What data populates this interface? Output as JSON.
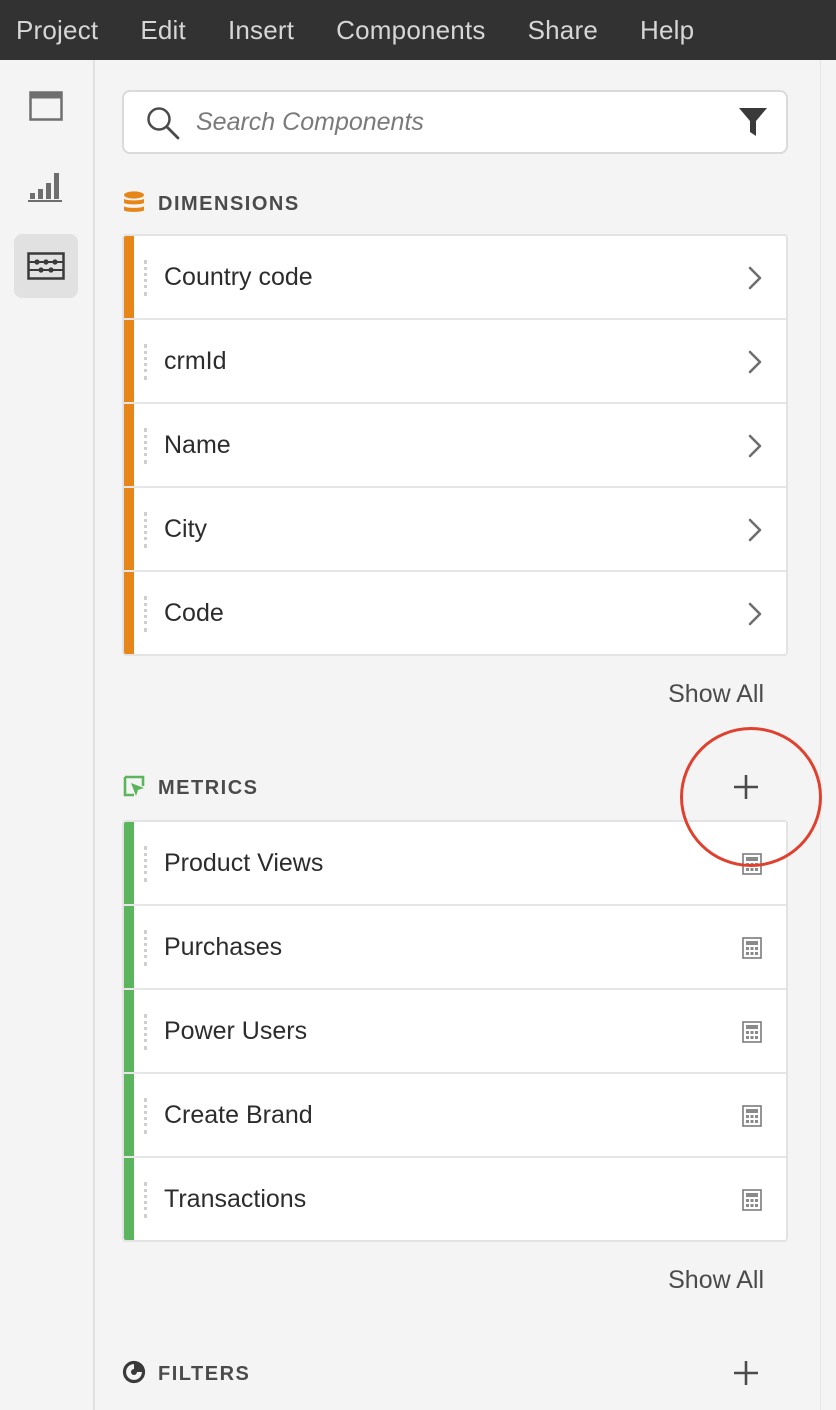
{
  "menubar": {
    "items": [
      "Project",
      "Edit",
      "Insert",
      "Components",
      "Share",
      "Help"
    ]
  },
  "rail": {
    "buttons": [
      {
        "icon": "panel-icon",
        "active": false
      },
      {
        "icon": "visualization-icon",
        "active": false
      },
      {
        "icon": "components-icon",
        "active": true
      }
    ]
  },
  "search": {
    "placeholder": "Search Components",
    "value": ""
  },
  "dimensions": {
    "title": "DIMENSIONS",
    "color": "#e68619",
    "items": [
      "Country code",
      "crmId",
      "Name",
      "City",
      "Code"
    ],
    "show_all": "Show All"
  },
  "metrics": {
    "title": "METRICS",
    "color": "#5ab55d",
    "items": [
      "Product Views",
      "Purchases",
      "Power Users",
      "Create Brand",
      "Transactions"
    ],
    "show_all": "Show All"
  },
  "filters": {
    "title": "FILTERS"
  },
  "annotation": {
    "color": "#e0412f"
  }
}
